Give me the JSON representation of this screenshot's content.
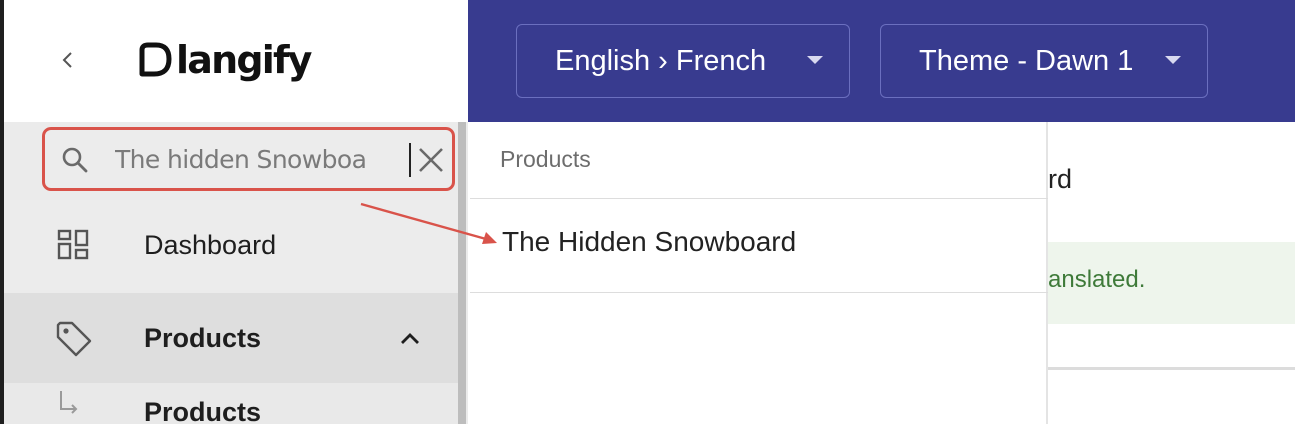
{
  "app": {
    "logo_text": "langify",
    "brand_color": "#383b8f"
  },
  "sidebar": {
    "search": {
      "value": "The hidden Snowboa",
      "highlight_color": "#d9534a"
    },
    "items": [
      {
        "label": "Dashboard",
        "icon": "dashboard-grid-icon"
      },
      {
        "label": "Products",
        "icon": "tag-icon",
        "expanded": true
      },
      {
        "label": "Products",
        "icon": "sub-arrow-icon"
      }
    ]
  },
  "topbar": {
    "language_selector": "English › French",
    "theme_selector": "Theme - Dawn 1"
  },
  "results": {
    "heading": "Products",
    "items": [
      {
        "label": "The Hidden Snowboard"
      }
    ]
  },
  "background": {
    "partial_title": "rd",
    "partial_banner": "anslated."
  }
}
